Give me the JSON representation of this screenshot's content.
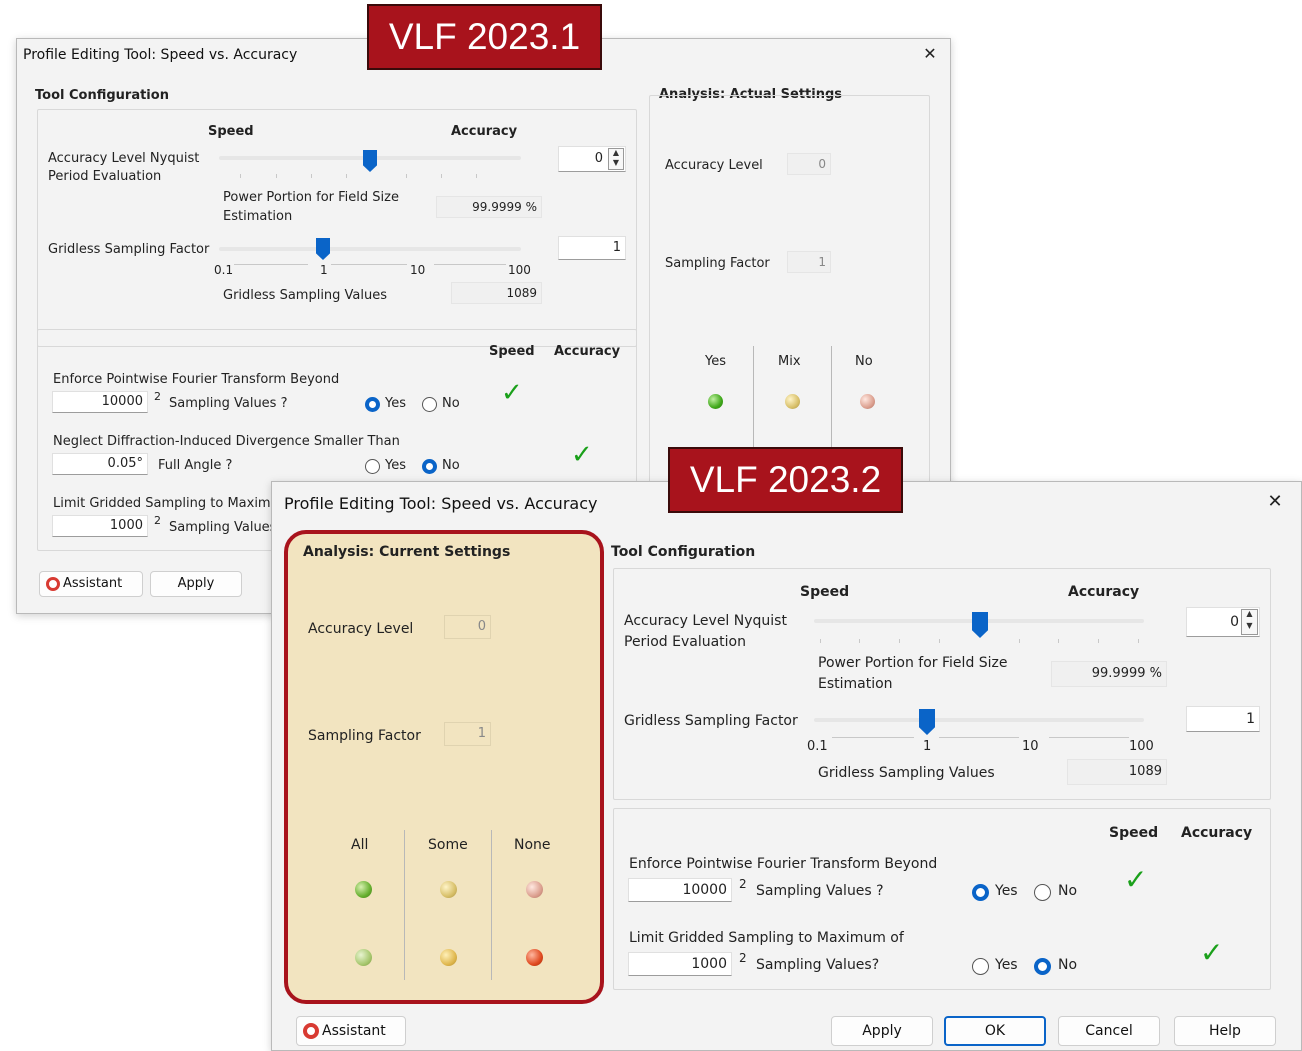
{
  "banner_old": "VLF 2023.1",
  "banner_new": "VLF 2023.2",
  "colors": {
    "brand_red": "#a8131c",
    "accent_blue": "#0a64c8",
    "check_green": "#1aa01a",
    "highlight_bg": "#f2e4c0"
  },
  "old": {
    "title": "Profile Editing Tool: Speed vs. Accuracy",
    "tool_config": "Tool Configuration",
    "speed": "Speed",
    "accuracy": "Accuracy",
    "accuracy_level_label": "Accuracy Level Nyquist Period Evaluation",
    "accuracy_level_value": "0",
    "accuracy_slider_position": 0.5,
    "power_label": "Power Portion for Field Size Estimation",
    "power_value": "99.9999 %",
    "gridless_label": "Gridless Sampling Factor",
    "gridless_value": "1",
    "gridless_ticks": [
      "0.1",
      "1",
      "10",
      "100"
    ],
    "gridless_values_label": "Gridless Sampling Values",
    "gridless_values": "1089",
    "col_speed": "Speed",
    "col_accuracy": "Accuracy",
    "opt1_label": "Enforce Pointwise Fourier Transform Beyond",
    "opt1_value": "10000",
    "opt1_sup": "2",
    "opt1_unit": "Sampling Values ?",
    "opt2_label": "Neglect Diffraction-Induced Divergence Smaller Than",
    "opt2_value": "0.05°",
    "opt2_unit": "Full Angle ?",
    "opt3_label": "Limit Gridded Sampling to Maximum of",
    "opt3_value": "1000",
    "opt3_sup": "2",
    "opt3_unit": "Sampling Values?",
    "yes": "Yes",
    "no": "No",
    "analysis_title": "Analysis: Actual Settings",
    "analysis_accuracy_label": "Accuracy Level",
    "analysis_accuracy_value": "0",
    "analysis_sampling_label": "Sampling Factor",
    "analysis_sampling_value": "1",
    "legend_yes": "Yes",
    "legend_mix": "Mix",
    "legend_no": "No",
    "assistant": "Assistant",
    "apply": "Apply",
    "check": "✓",
    "close": "✕"
  },
  "new": {
    "title": "Profile Editing Tool: Speed vs. Accuracy",
    "analysis_title": "Analysis: Current Settings",
    "analysis_accuracy_label": "Accuracy Level",
    "analysis_accuracy_value": "0",
    "analysis_sampling_label": "Sampling Factor",
    "analysis_sampling_value": "1",
    "legend_all": "All",
    "legend_some": "Some",
    "legend_none": "None",
    "tool_config": "Tool Configuration",
    "speed": "Speed",
    "accuracy": "Accuracy",
    "accuracy_level_label_1": "Accuracy Level Nyquist",
    "accuracy_level_label_2": "Period Evaluation",
    "accuracy_level_value": "0",
    "accuracy_slider_position": 0.5,
    "power_label_1": "Power Portion for Field Size",
    "power_label_2": "Estimation",
    "power_value": "99.9999 %",
    "gridless_label": "Gridless Sampling Factor",
    "gridless_value": "1",
    "gridless_ticks": [
      "0.1",
      "1",
      "10",
      "100"
    ],
    "gridless_values_label": "Gridless Sampling Values",
    "gridless_values": "1089",
    "col_speed": "Speed",
    "col_accuracy": "Accuracy",
    "opt1_label": "Enforce Pointwise Fourier Transform Beyond",
    "opt1_value": "10000",
    "opt1_sup": "2",
    "opt1_unit": "Sampling Values ?",
    "opt2_label": "Limit Gridded Sampling to Maximum of",
    "opt2_value": "1000",
    "opt2_sup": "2",
    "opt2_unit": "Sampling Values?",
    "yes": "Yes",
    "no": "No",
    "assistant": "Assistant",
    "apply": "Apply",
    "ok": "OK",
    "cancel": "Cancel",
    "help": "Help",
    "check": "✓",
    "close": "✕"
  }
}
